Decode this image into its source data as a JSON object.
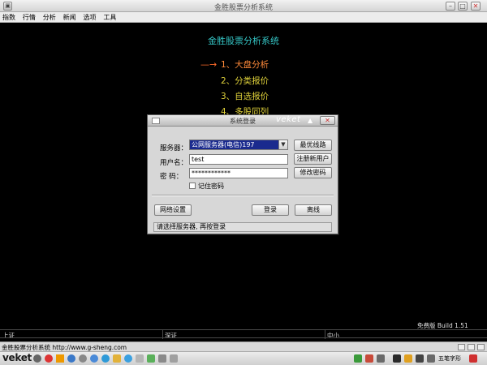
{
  "window": {
    "title": "金胜股票分析系统"
  },
  "menubar": {
    "items": [
      "指数",
      "行情",
      "分析",
      "新闻",
      "选项",
      "工具"
    ]
  },
  "main": {
    "title": "金胜股票分析系统",
    "arrow": "—→",
    "items": [
      "1、大盘分析",
      "2、分类报价",
      "3、自选报价",
      "4、多股同列"
    ]
  },
  "login": {
    "title": "系统登录",
    "server_label": "服务器：",
    "server_value": "公网服务器(电信)197",
    "user_label": "用户名：",
    "user_value": "test",
    "pwd_label": "密  码：",
    "pwd_value": "************",
    "best_route": "最优线路",
    "register": "注册新用户",
    "change_pwd": "修改密码",
    "remember": "记住密码",
    "network": "网络设置",
    "login_btn": "登录",
    "exit_btn": "离线",
    "status": "请选择服务器, 再按登录"
  },
  "footer": {
    "build": "免费版 Build 1.51",
    "left1": "上证",
    "mid1": "深证",
    "right1": "中小",
    "url": "金胜股票分析系统 http://www.g-sheng.com"
  },
  "taskbar": {
    "start": "veket",
    "clock": "五笔字形"
  },
  "colors": {
    "title_cyan": "#35c7c7",
    "menu_yellow": "#e0d23a",
    "menu_active": "#ff8a3a",
    "select_bg": "#1a2a8e"
  }
}
